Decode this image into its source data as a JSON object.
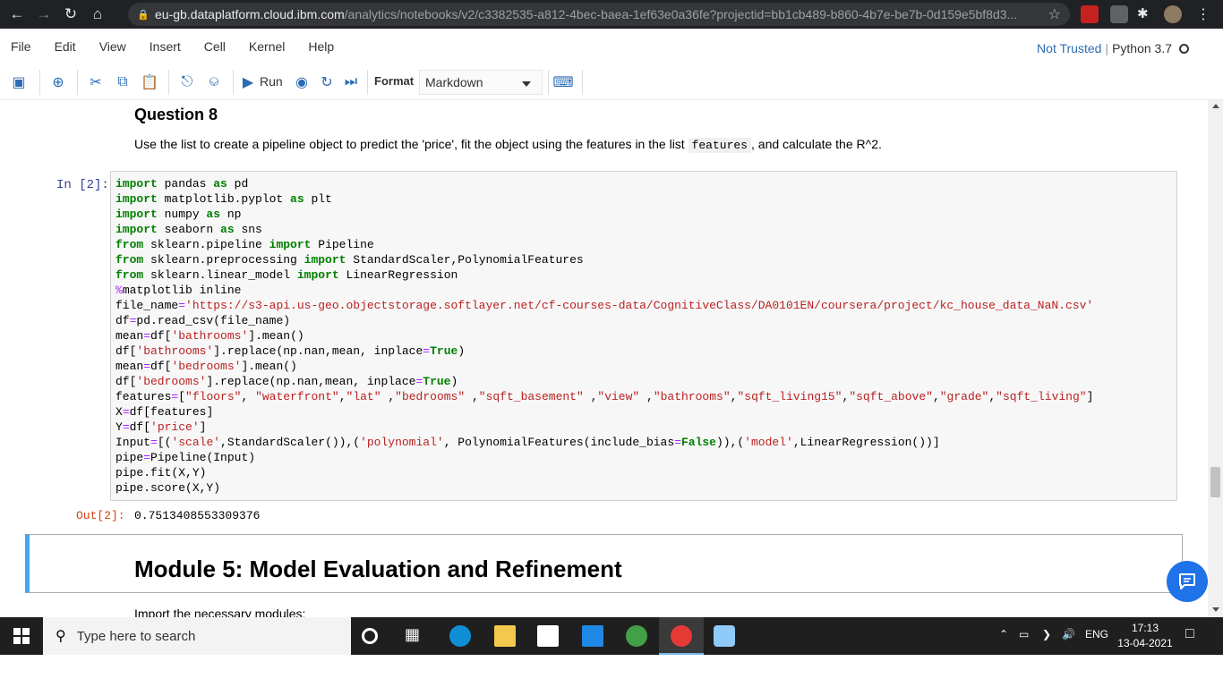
{
  "browser": {
    "url_host": "eu-gb.dataplatform.cloud.ibm.com",
    "url_path": "/analytics/notebooks/v2/c3382535-a812-4bec-baea-1ef63e0a36fe?projectid=bb1cb489-b860-4b7e-be7b-0d159e5bf8d3..."
  },
  "menu": {
    "items": [
      "File",
      "Edit",
      "View",
      "Insert",
      "Cell",
      "Kernel",
      "Help"
    ],
    "trust": "Not Trusted",
    "kernel": "Python 3.7"
  },
  "toolbar": {
    "run_label": "Run",
    "format_label": "Format",
    "format_value": "Markdown"
  },
  "notebook": {
    "question_title": "Question 8",
    "question_text_before": "Use the list to create a pipeline object to predict the 'price', fit the object using the features in the list",
    "question_code": "features",
    "question_text_after": ", and calculate the R^2.",
    "in_prompt": "In [2]:",
    "out_prompt": "Out[2]:",
    "output_value": "0.7513408553309376",
    "module_title": "Module 5: Model Evaluation and Refinement",
    "next_text": "Import the necessary modules:"
  },
  "taskbar": {
    "search_placeholder": "Type here to search",
    "lang": "ENG",
    "time": "17:13",
    "date": "13-04-2021"
  },
  "colors": {
    "accent_blue": "#42a5f5",
    "toolbar_icon": "#2b6cb5",
    "prompt_in": "#303f9f",
    "prompt_out": "#d84315"
  }
}
